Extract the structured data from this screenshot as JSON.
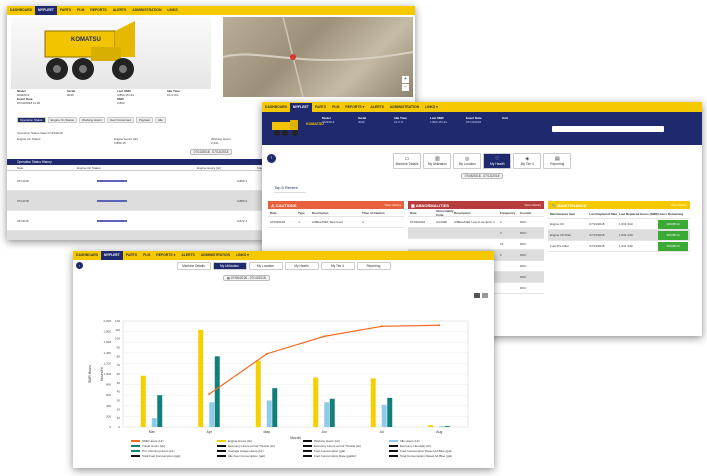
{
  "nav1": {
    "items": [
      "DASHBOARD",
      "MYFLEET",
      "PARTS",
      "PLM",
      "REPORTS",
      "ALERTS",
      "ADMINISTRATION",
      "LINKS"
    ],
    "active": 1
  },
  "nav2": {
    "items": [
      "DASHBOARD",
      "MYFLEET",
      "PARTS",
      "PLM",
      "REPORTS ▾",
      "ALERTS",
      "ADMINISTRATION",
      "LINKS ▾"
    ],
    "active": 1
  },
  "nav3": {
    "items": [
      "DASHBOARD",
      "MYFLEET",
      "PARTS",
      "PLM",
      "REPORTS ▾",
      "ALERTS",
      "ADMINISTRATION",
      "LINKS ▾"
    ],
    "active": 1
  },
  "shot1": {
    "brand": "KOMATSU",
    "info_headers": [
      "Model",
      "Serial",
      "Last SMR",
      "Idle Time"
    ],
    "info_values": [
      "HM400-5",
      "3046",
      "3,893.15 Hrs",
      "10.3 Hrs"
    ],
    "info_headers2": [
      "Event Date",
      "",
      "SMR",
      ""
    ],
    "info_values2": [
      "07/13/2018 11:30",
      "",
      "3,893",
      ""
    ],
    "filters": [
      "Operation Status",
      "Engine On Status",
      "Working Hours",
      "Fuel Consumed",
      "Payload",
      "Idle"
    ],
    "section_title": "Operation Status Date 07/13/2018",
    "metric_labels": [
      "Engine On Status",
      "Engine Hours (Hr)",
      "Working Hours",
      "Fuel"
    ],
    "metric_values": [
      "",
      "3,893.15",
      "2,441",
      "0"
    ],
    "range_label": "07/13/2018 - 07/13/2018",
    "table_title": "Operation Status History",
    "table_headers": [
      "Date",
      "Engine On Status",
      "",
      "Engine Hours (Hr)",
      "Fuel (L)"
    ],
    "rows": [
      {
        "date": "07/13/18",
        "hours": "3,893.1",
        "fuel": "221.3"
      },
      {
        "date": "07/12/18",
        "hours": "3,880.3",
        "fuel": "219.2"
      },
      {
        "date": "07/11/18",
        "hours": "3,872.1",
        "fuel": "216.2"
      },
      {
        "date": "07/10/18",
        "hours": "3,864.4",
        "fuel": "215.8"
      }
    ]
  },
  "shot2": {
    "brand": "KOMATSU",
    "info_headers": [
      "Model",
      "Serial",
      "Idle Time",
      "Last SMR",
      "Event Date",
      "Unit"
    ],
    "info_values": [
      "HM400-5",
      "3046",
      "10.3 %",
      "1,893.15 Hrs",
      "07/13/2018",
      ""
    ],
    "tabs": [
      {
        "label": "Machine Details",
        "icon": "doc-icon"
      },
      {
        "label": "My Utilization",
        "icon": "chart-icon"
      },
      {
        "label": "My Location",
        "icon": "location-icon"
      },
      {
        "label": "My Health",
        "icon": "health-icon"
      },
      {
        "label": "My Tier 4",
        "icon": "tier-icon"
      },
      {
        "label": "Reporting",
        "icon": "report-icon"
      }
    ],
    "active_tab": 3,
    "date_range": "07/06/2018 - 07/13/2018",
    "top5": "Top 5 Recent",
    "cautions": {
      "title": "CAUTIONS",
      "link": "View History",
      "headers": [
        "Date",
        "Type",
        "Description",
        "Time of Caution"
      ],
      "rows": [
        {
          "date": "07/09/2018",
          "type": "⚠",
          "desc": "AdBlue/DEF Tank level",
          "time": "4"
        }
      ]
    },
    "abnormalities": {
      "title": "ABNORMALITIES",
      "link": "View History",
      "headers": [
        "Date",
        "Abnormality Code",
        "Description",
        "Frequency",
        "Counter"
      ],
      "rows": [
        {
          "date": "07/06/2018",
          "code": "CA3498",
          "desc": "AdBlue/DEF Level Low Error 1",
          "freq": "2",
          "counter": "DNC"
        },
        {
          "date": "",
          "code": "",
          "desc": "",
          "freq": "4",
          "counter": "DNC"
        },
        {
          "date": "",
          "code": "",
          "desc": "",
          "freq": "16",
          "counter": "DNC"
        },
        {
          "date": "",
          "code": "",
          "desc": "",
          "freq": "2",
          "counter": "DNC"
        },
        {
          "date": "",
          "code": "",
          "desc": "",
          "freq": "",
          "counter": "DNC"
        },
        {
          "date": "",
          "code": "",
          "desc": "",
          "freq": "",
          "counter": "DNC"
        },
        {
          "date": "",
          "code": "",
          "desc": "",
          "freq": "",
          "counter": "DNC"
        }
      ]
    },
    "maintenance": {
      "title": "MAINTENANCE",
      "link": "View History",
      "headers": [
        "Maintenance Item",
        "Last Replaced Date",
        "Last Replaced Hours (SMR)",
        "Hours Remaining"
      ],
      "rows": [
        {
          "item": "Engine Oil",
          "date": "07/13/2018",
          "hours": "1,631.3/Hr",
          "remain": "209.88 Hr"
        },
        {
          "item": "Engine Oil Filter",
          "date": "07/13/2018",
          "hours": "1,631.3/Hr",
          "remain": "209.88 Hr"
        },
        {
          "item": "Fuel Pre-Filter",
          "date": "07/13/2018",
          "hours": "1,631.3/Hr",
          "remain": "209.88 Hr"
        }
      ]
    }
  },
  "shot3": {
    "tabs": [
      "Machine Details",
      "My Utilization",
      "My Location",
      "My Health",
      "My Tier 4",
      "Reporting"
    ],
    "active_tab": 1,
    "date_range": "07/06/2018 - 07/13/2018",
    "xlabel": "Month",
    "ylabel_left": "SMR Hours",
    "ylabel_right": "Hours/Hr"
  },
  "chart_data": {
    "type": "bar",
    "title": "",
    "xlabel": "Month",
    "ylabel": "SMR Hours",
    "categories": [
      "Mar",
      "Apr",
      "May",
      "Jun",
      "Jul",
      "Aug"
    ],
    "ylim": [
      0,
      2000
    ],
    "y_ticks": [
      "0",
      "200",
      "400",
      "600",
      "800",
      "1,000",
      "1,200",
      "1,400",
      "1,600",
      "1,800",
      "2,000"
    ],
    "y2lim": [
      0,
      120
    ],
    "y2_ticks": [
      "0",
      "10",
      "20",
      "30",
      "40",
      "50",
      "60",
      "70",
      "80",
      "90",
      "100",
      "110",
      "120"
    ],
    "series": [
      {
        "name": "SMR Hours (Hr)",
        "kind": "line",
        "color": "#f26a21",
        "values": [
          null,
          620,
          1380,
          1710,
          1900,
          1920
        ]
      },
      {
        "name": "Engine Hours (Hr)",
        "kind": "bar",
        "color": "#f5d000",
        "values": [
          58,
          110,
          75,
          56,
          55,
          2
        ]
      },
      {
        "name": "Working Hours (Hr)",
        "kind": "bar",
        "color": "#1f2a6e",
        "values": [
          0,
          0,
          0,
          0,
          0,
          0
        ]
      },
      {
        "name": "Idle Hours (Hr)",
        "kind": "bar",
        "color": "#8ecbe8",
        "values": [
          10,
          28,
          30,
          28,
          25,
          1
        ]
      },
      {
        "name": "Travel Hours (Hr)",
        "kind": "bar",
        "color": "#12807a",
        "values": [
          36,
          80,
          44,
          32,
          33,
          1
        ]
      }
    ],
    "legend": [
      {
        "name": "SMR Hours (Hr)",
        "color": "#f26a21"
      },
      {
        "name": "Engine Hours (Hr)",
        "color": "#f5d000"
      },
      {
        "name": "Working Hours (Hr)",
        "color": "#111111"
      },
      {
        "name": "Idle Hours (Hr)",
        "color": "#8ecbe8"
      },
      {
        "name": "Travel Hours (Hr)",
        "color": "#12807a"
      },
      {
        "name": "Economy Hours at Full Throttle (Hr)",
        "color": "#111111"
      },
      {
        "name": "Economy Hours at Full Throttle (Hr)",
        "color": "#111111"
      },
      {
        "name": "Economy Hours(E) (Hr)",
        "color": "#111111"
      },
      {
        "name": "P.O. Running Hours (Hr)",
        "color": "#12807a"
      },
      {
        "name": "Average Usage Hours (Hr)",
        "color": "#111111"
      },
      {
        "name": "Fuel Consumption (gal)",
        "color": "#111111"
      },
      {
        "name": "Fuel Consumption Diesel Ad Blue (gal)",
        "color": "#111111"
      },
      {
        "name": "Total Fuel Consumption (gal)",
        "color": "#111111"
      },
      {
        "name": "Idle Fuel Consumption (gal)",
        "color": "#111111"
      },
      {
        "name": "Fuel Consumption Rate (gal/Hr)",
        "color": "#111111"
      },
      {
        "name": "Total Consumption Diesel Ad Blue (gal)",
        "color": "#111111"
      }
    ]
  }
}
